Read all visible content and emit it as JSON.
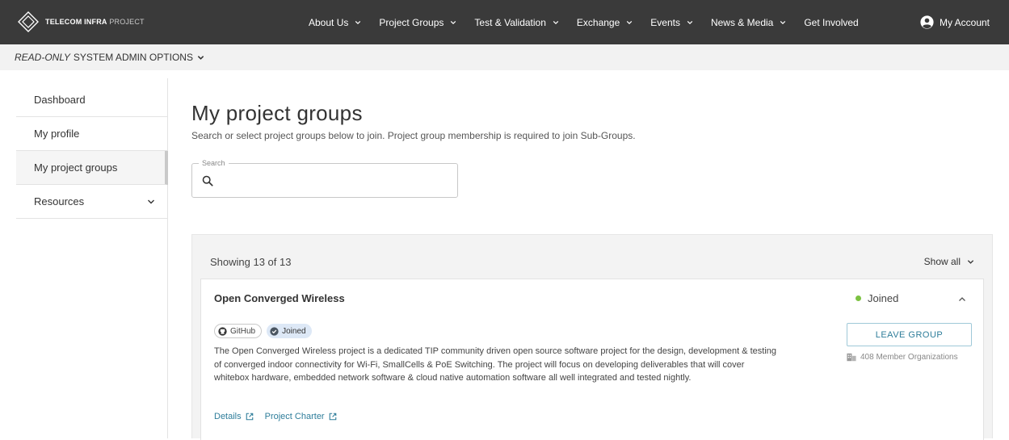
{
  "header": {
    "logo": {
      "brand_bold": "TELECOM INFRA",
      "brand_light": "PROJECT"
    },
    "nav": [
      {
        "label": "About Us",
        "has_dropdown": true
      },
      {
        "label": "Project Groups",
        "has_dropdown": true
      },
      {
        "label": "Test & Validation",
        "has_dropdown": true
      },
      {
        "label": "Exchange",
        "has_dropdown": true
      },
      {
        "label": "Events",
        "has_dropdown": true
      },
      {
        "label": "News & Media",
        "has_dropdown": true
      },
      {
        "label": "Get Involved",
        "has_dropdown": false
      }
    ],
    "account_label": "My Account"
  },
  "admin_bar": {
    "italic": "READ-ONLY",
    "rest": "SYSTEM ADMIN OPTIONS"
  },
  "sidebar": {
    "items": [
      {
        "label": "Dashboard",
        "active": false
      },
      {
        "label": "My profile",
        "active": false
      },
      {
        "label": "My project groups",
        "active": true
      },
      {
        "label": "Resources",
        "active": false,
        "has_dropdown": true
      }
    ]
  },
  "main": {
    "title": "My project groups",
    "subtitle": "Search or select project groups below to join. Project group membership is required to join Sub-Groups.",
    "search": {
      "legend": "Search",
      "value": "",
      "placeholder": ""
    },
    "list": {
      "showing": "Showing 13 of 13",
      "show_all": "Show all"
    },
    "card": {
      "title": "Open Converged Wireless",
      "status": "Joined",
      "tags": {
        "github": "GitHub",
        "joined": "Joined"
      },
      "description": "The Open Converged Wireless project is a dedicated TIP community driven open source software project for the design, development & testing of converged indoor connectivity for Wi-Fi, SmallCells & PoE Switching. The project will focus on developing deliverables that will cover whitebox hardware, embedded network software & cloud native automation software all well integrated and tested nightly.",
      "links": {
        "details": "Details",
        "charter": "Project Charter"
      },
      "leave_button": "LEAVE GROUP",
      "members": "408 Member Organizations"
    }
  },
  "colors": {
    "topbar": "#3a3a3a",
    "accent_link": "#2e7d9a",
    "joined_dot": "#7cc242",
    "joined_tag_bg": "#dde8f6"
  },
  "icons": {
    "logo": "tip-diamond-logo",
    "account": "user-circle-icon",
    "search": "search-icon",
    "github": "github-icon",
    "joined": "check-circle-icon",
    "external": "external-link-icon",
    "members": "building-icon"
  }
}
